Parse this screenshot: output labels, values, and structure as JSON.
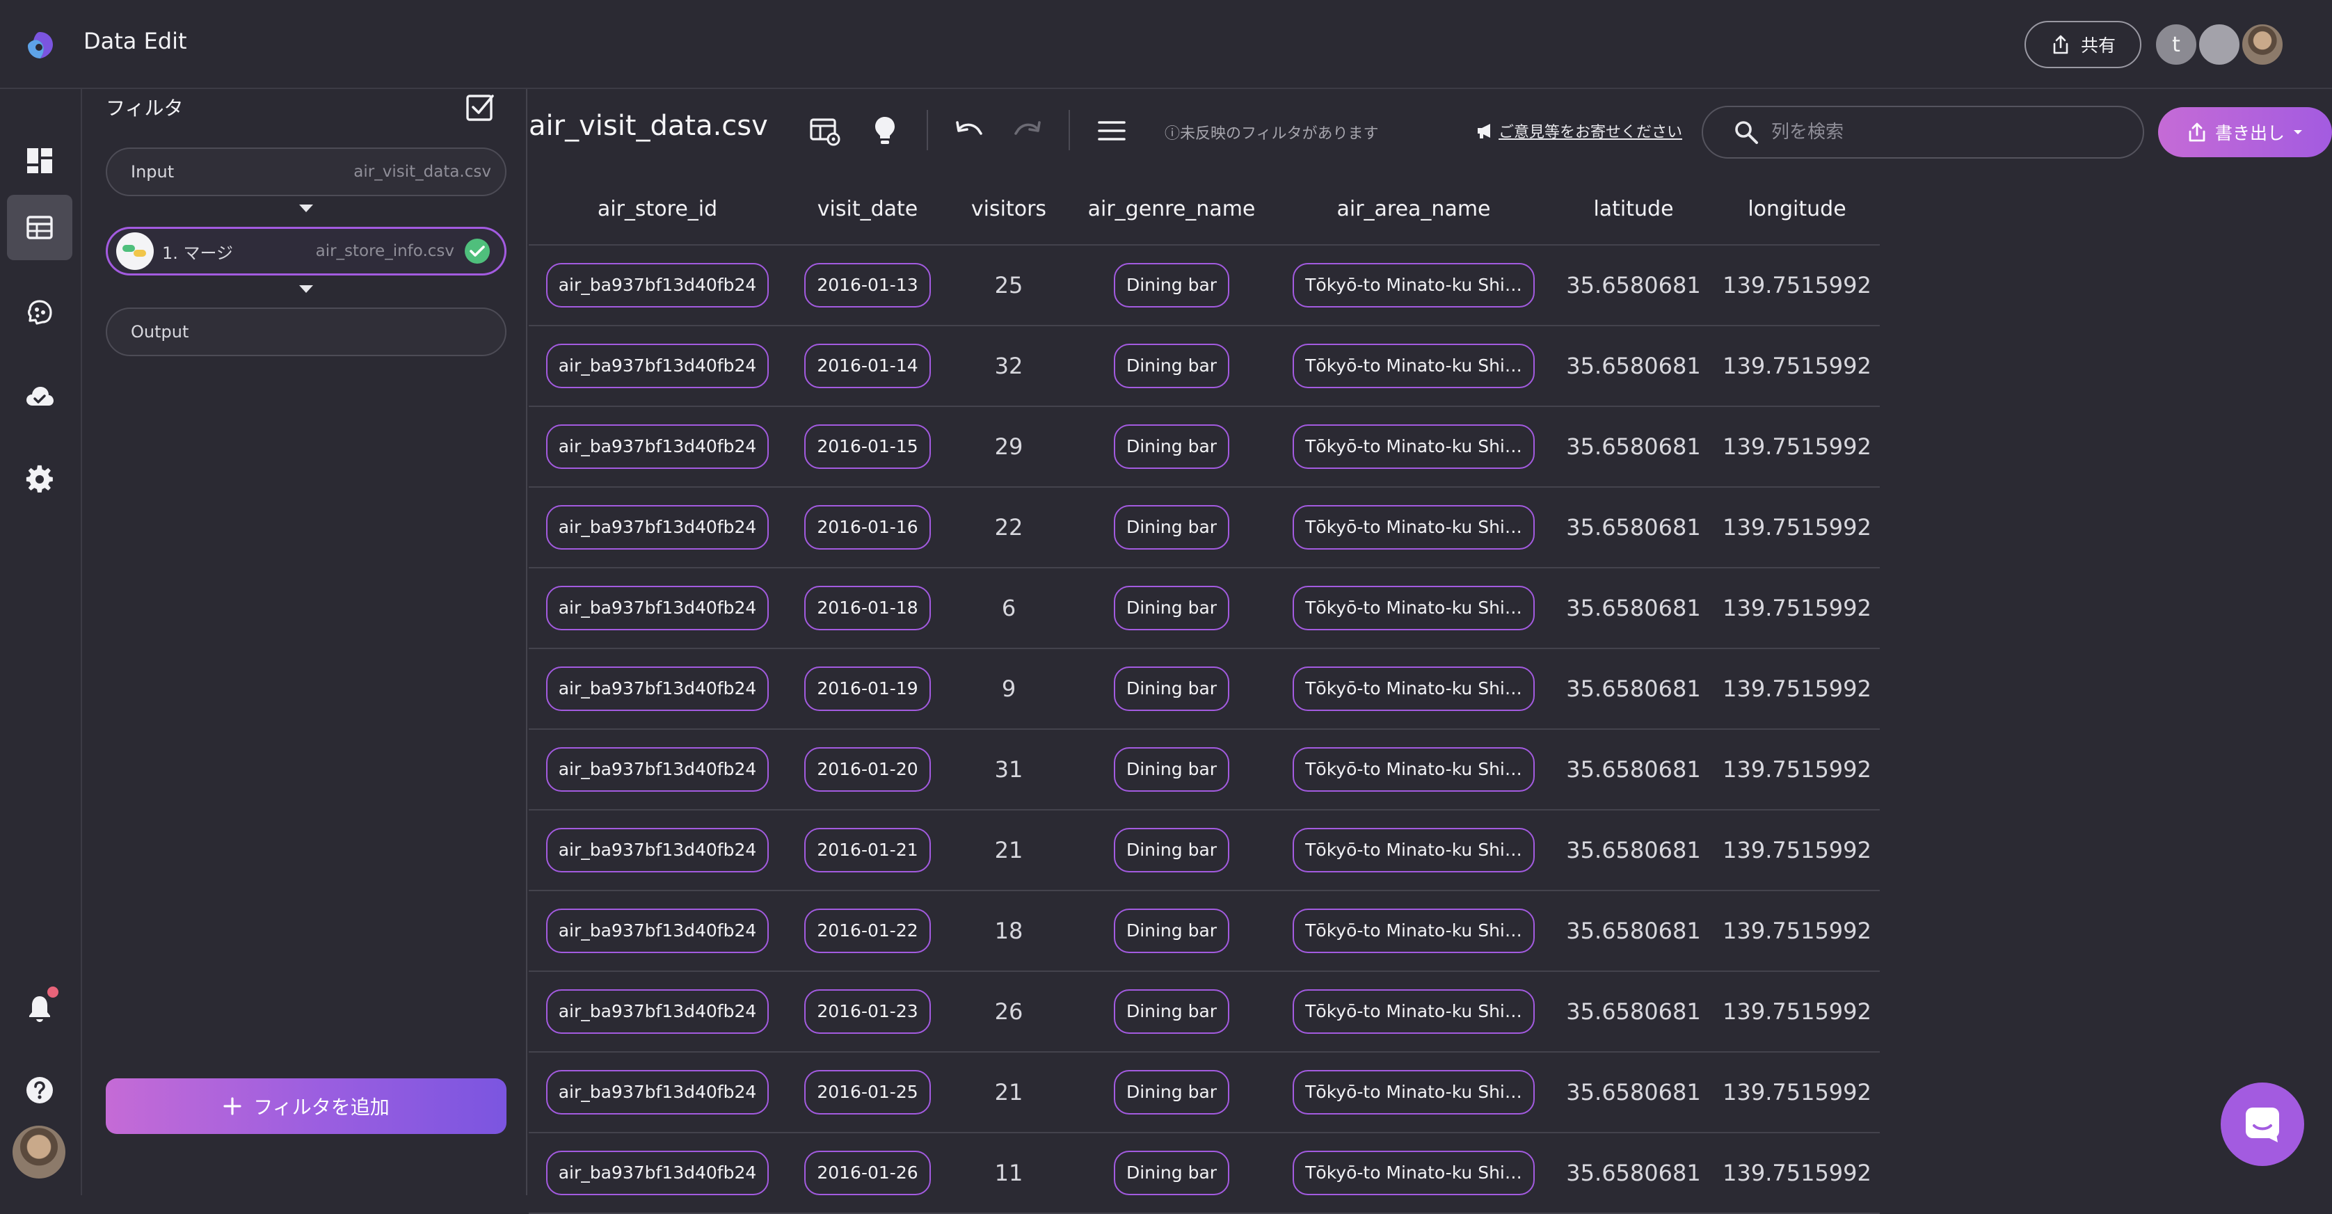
{
  "app": {
    "title": "Data Edit"
  },
  "header": {
    "share_label": "共有",
    "avatar_letter": "t"
  },
  "rail": {
    "items": [
      "dashboard-icon",
      "table-icon",
      "brain-icon",
      "cloud-icon",
      "settings-icon",
      "bell-icon",
      "help-icon"
    ],
    "active": "table-icon"
  },
  "filters": {
    "title": "フィルタ",
    "steps": [
      {
        "label": "Input",
        "value": "air_visit_data.csv"
      },
      {
        "label": "1. マージ",
        "value": "air_store_info.csv",
        "status": "ok"
      },
      {
        "label": "Output",
        "value": ""
      }
    ],
    "add_label": "フィルタを追加"
  },
  "toolbar": {
    "file_name": "air_visit_data.csv",
    "unsynced_notice": "ⓘ未反映のフィルタがあります",
    "feedback_link": "ご意見等をお寄せください",
    "search_placeholder": "列を検索",
    "export_label": "書き出し"
  },
  "table": {
    "columns": [
      "air_store_id",
      "visit_date",
      "visitors",
      "air_genre_name",
      "air_area_name",
      "latitude",
      "longitude"
    ],
    "rows": [
      [
        "air_ba937bf13d40fb24",
        "2016-01-13",
        "25",
        "Dining bar",
        "Tōkyō-to Minato-ku Shi…",
        "35.6580681",
        "139.7515992"
      ],
      [
        "air_ba937bf13d40fb24",
        "2016-01-14",
        "32",
        "Dining bar",
        "Tōkyō-to Minato-ku Shi…",
        "35.6580681",
        "139.7515992"
      ],
      [
        "air_ba937bf13d40fb24",
        "2016-01-15",
        "29",
        "Dining bar",
        "Tōkyō-to Minato-ku Shi…",
        "35.6580681",
        "139.7515992"
      ],
      [
        "air_ba937bf13d40fb24",
        "2016-01-16",
        "22",
        "Dining bar",
        "Tōkyō-to Minato-ku Shi…",
        "35.6580681",
        "139.7515992"
      ],
      [
        "air_ba937bf13d40fb24",
        "2016-01-18",
        "6",
        "Dining bar",
        "Tōkyō-to Minato-ku Shi…",
        "35.6580681",
        "139.7515992"
      ],
      [
        "air_ba937bf13d40fb24",
        "2016-01-19",
        "9",
        "Dining bar",
        "Tōkyō-to Minato-ku Shi…",
        "35.6580681",
        "139.7515992"
      ],
      [
        "air_ba937bf13d40fb24",
        "2016-01-20",
        "31",
        "Dining bar",
        "Tōkyō-to Minato-ku Shi…",
        "35.6580681",
        "139.7515992"
      ],
      [
        "air_ba937bf13d40fb24",
        "2016-01-21",
        "21",
        "Dining bar",
        "Tōkyō-to Minato-ku Shi…",
        "35.6580681",
        "139.7515992"
      ],
      [
        "air_ba937bf13d40fb24",
        "2016-01-22",
        "18",
        "Dining bar",
        "Tōkyō-to Minato-ku Shi…",
        "35.6580681",
        "139.7515992"
      ],
      [
        "air_ba937bf13d40fb24",
        "2016-01-23",
        "26",
        "Dining bar",
        "Tōkyō-to Minato-ku Shi…",
        "35.6580681",
        "139.7515992"
      ],
      [
        "air_ba937bf13d40fb24",
        "2016-01-25",
        "21",
        "Dining bar",
        "Tōkyō-to Minato-ku Shi…",
        "35.6580681",
        "139.7515992"
      ],
      [
        "air_ba937bf13d40fb24",
        "2016-01-26",
        "11",
        "Dining bar",
        "Tōkyō-to Minato-ku Shi…",
        "35.6580681",
        "139.7515992"
      ]
    ]
  },
  "colors": {
    "accent": "#a35be0",
    "background": "#2b2a33",
    "notification": "#e8647a",
    "success": "#4fbf7c"
  }
}
